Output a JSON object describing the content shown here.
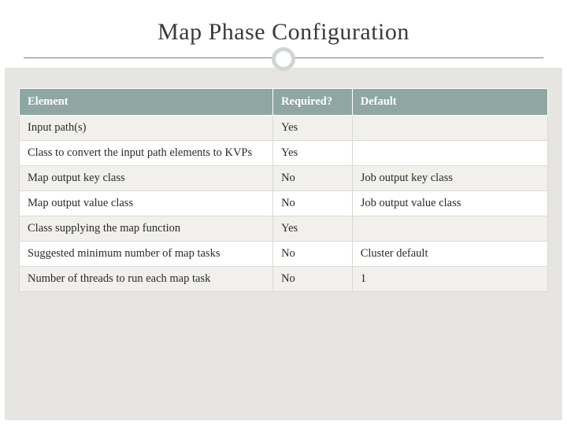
{
  "title": "Map Phase Configuration",
  "table": {
    "headers": {
      "element": "Element",
      "required": "Required?",
      "default": "Default"
    },
    "rows": [
      {
        "element": "Input path(s)",
        "required": "Yes",
        "default": ""
      },
      {
        "element": "Class to convert the input path elements to KVPs",
        "required": "Yes",
        "default": ""
      },
      {
        "element": "Map output key class",
        "required": "No",
        "default": "Job output key class"
      },
      {
        "element": "Map output value class",
        "required": "No",
        "default": "Job output value class"
      },
      {
        "element": "Class supplying the map function",
        "required": "Yes",
        "default": ""
      },
      {
        "element": "Suggested minimum number of map tasks",
        "required": "No",
        "default": "Cluster default"
      },
      {
        "element": "Number of threads to run each map task",
        "required": "No",
        "default": "1"
      }
    ]
  }
}
